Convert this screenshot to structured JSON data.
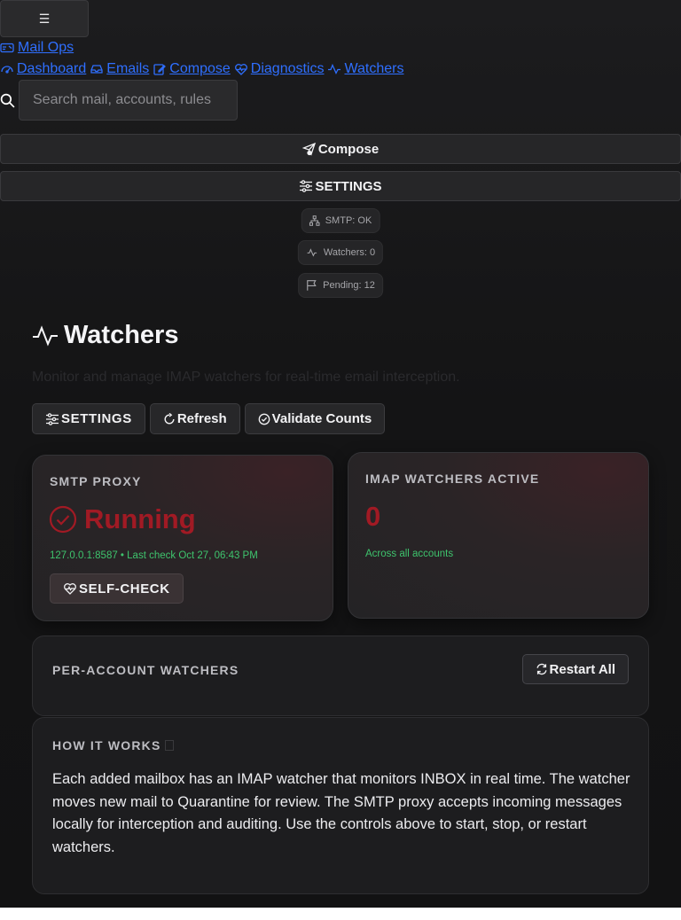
{
  "header": {
    "menu_icon": "☰",
    "brand_label": "Mail Ops",
    "nav": [
      {
        "label": "Dashboard",
        "icon": "dashboard-icon"
      },
      {
        "label": "Emails",
        "icon": "inbox-icon"
      },
      {
        "label": "Compose",
        "icon": "edit-icon"
      },
      {
        "label": "Diagnostics",
        "icon": "heart-pulse-icon"
      },
      {
        "label": "Watchers",
        "icon": "activity-icon"
      }
    ],
    "search_placeholder": "Search mail, accounts, rules",
    "compose_button": "Compose",
    "settings_button": "SETTINGS"
  },
  "status_pills": {
    "smtp": "SMTP: OK",
    "watchers": "Watchers: 0",
    "pending": "Pending: 12"
  },
  "page": {
    "title": "Watchers",
    "subtitle": "Monitor and manage IMAP watchers for real-time email interception.",
    "actions": {
      "settings": "SETTINGS",
      "refresh": "Refresh",
      "validate": "Validate Counts"
    }
  },
  "cards": {
    "smtp_proxy": {
      "label": "SMTP PROXY",
      "status": "Running",
      "detail": "127.0.0.1:8587 • Last check Oct 27, 06:43 PM",
      "self_check": "SELF-CHECK"
    },
    "imap_watchers": {
      "label": "IMAP WATCHERS ACTIVE",
      "count": "0",
      "detail": "Across all accounts"
    }
  },
  "per_account": {
    "label": "PER-ACCOUNT WATCHERS",
    "restart_all": "Restart All"
  },
  "how_it_works": {
    "label": "HOW IT WORKS",
    "text": "Each added mailbox has an IMAP watcher that monitors INBOX in real time. The watcher moves new mail to Quarantine for review. The SMTP proxy accepts incoming messages locally for interception and auditing. Use the controls above to start, stop, or restart watchers."
  },
  "colors": {
    "link": "#2f6fff",
    "status_red": "#a11a24",
    "ok_green": "#3ec46d",
    "background": "#161617"
  }
}
